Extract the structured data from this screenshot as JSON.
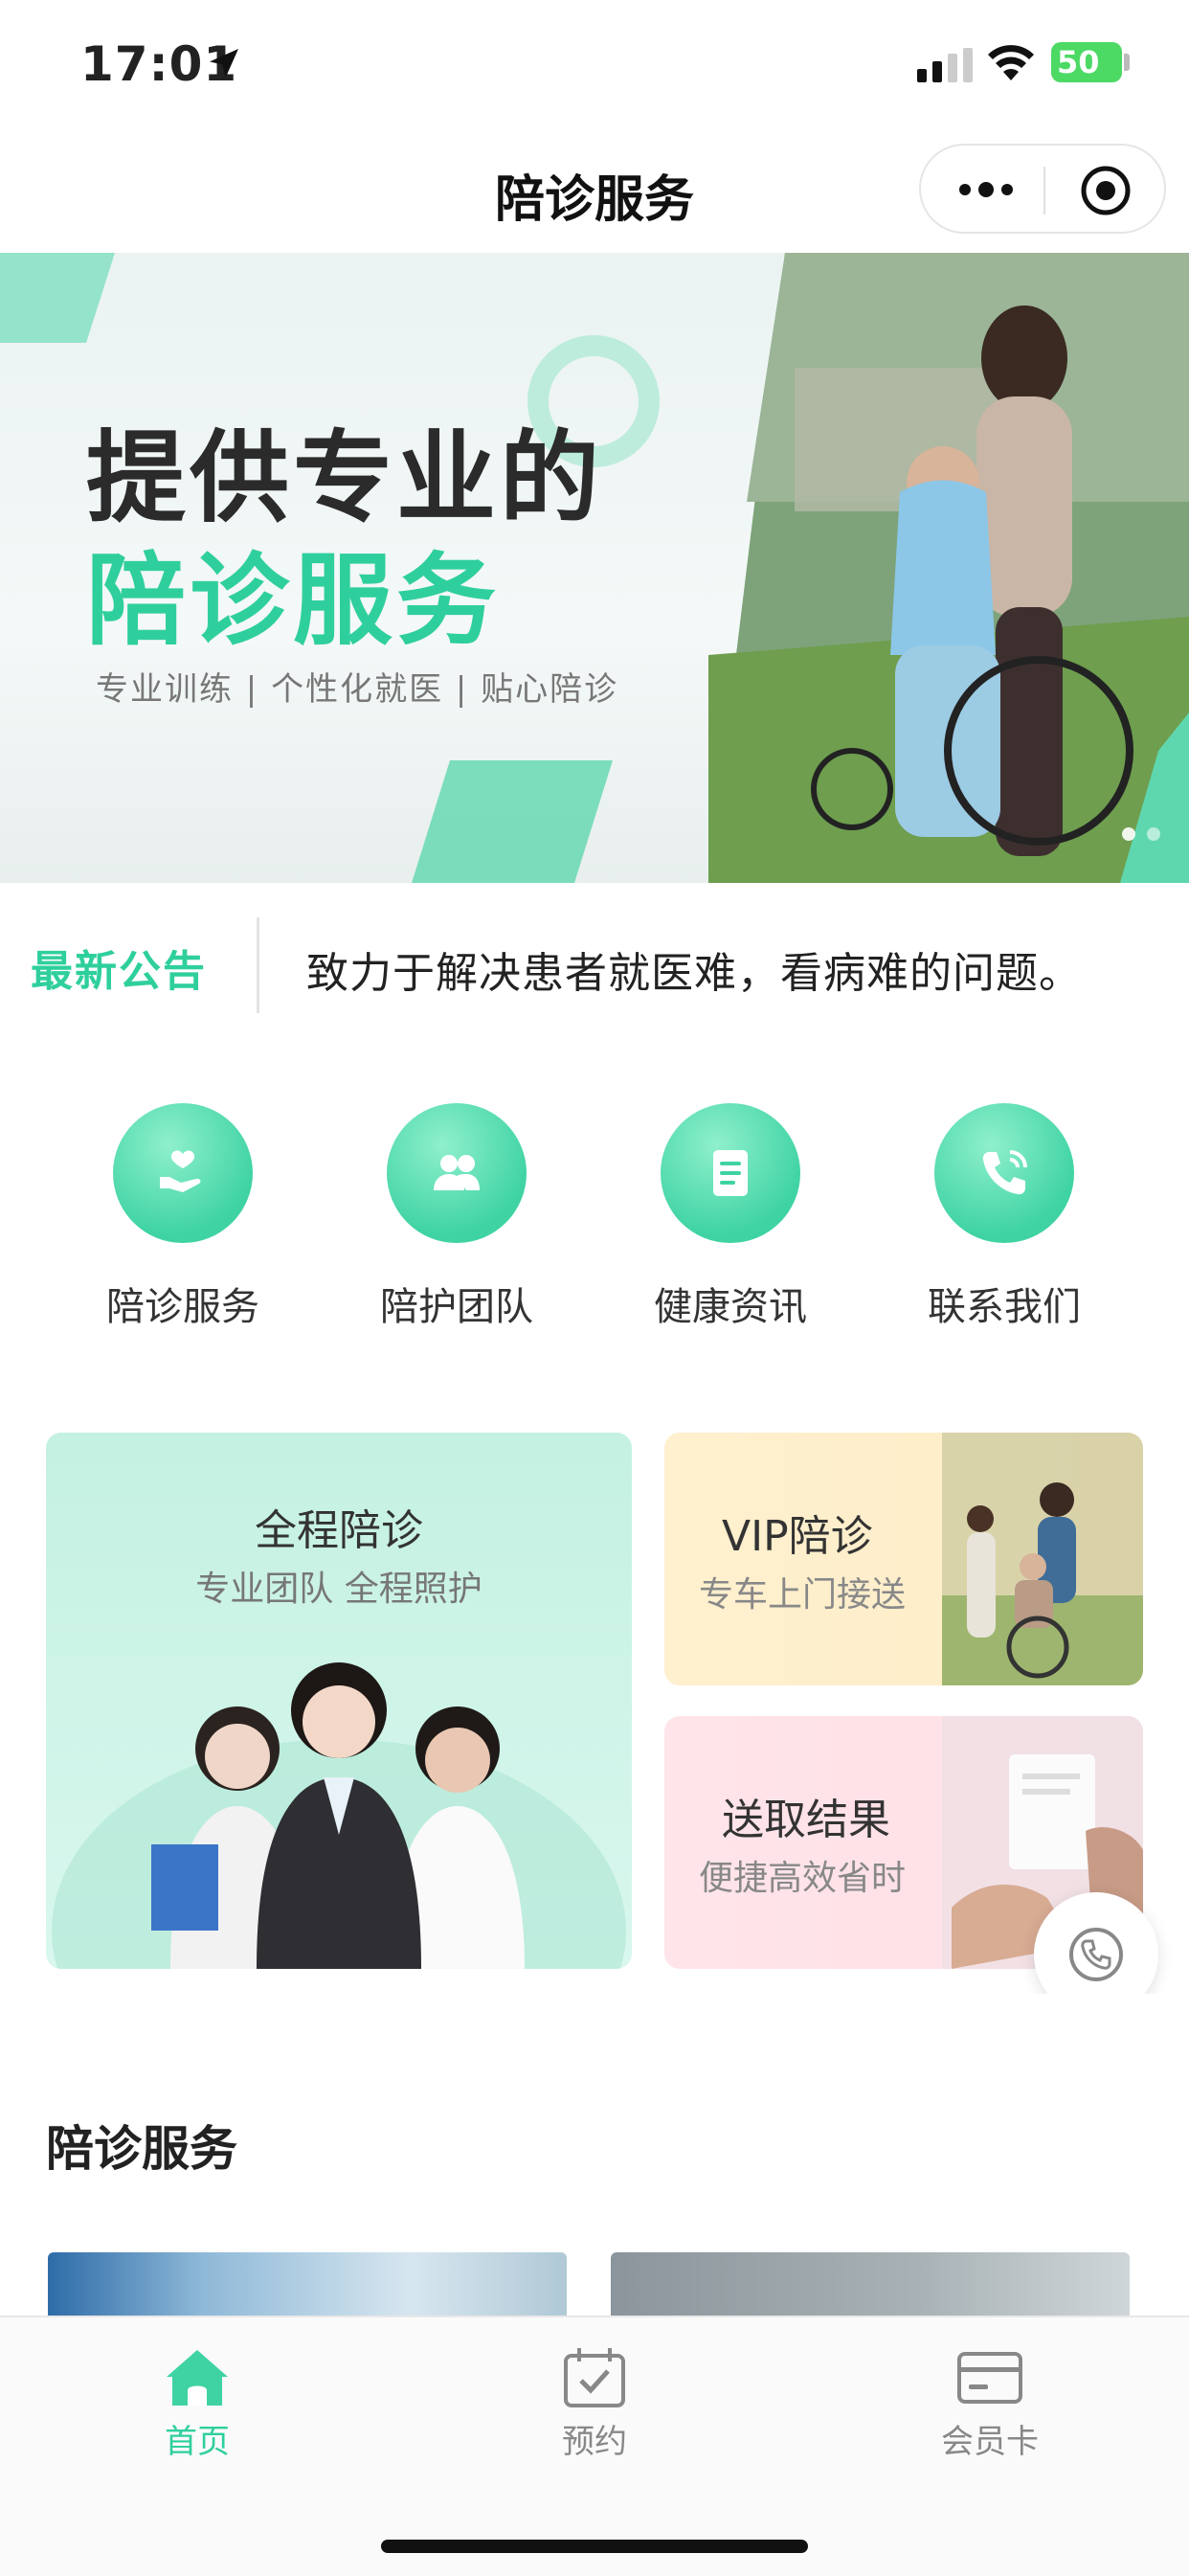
{
  "status_bar": {
    "time": "17:01",
    "battery": "50"
  },
  "nav": {
    "title": "陪诊服务"
  },
  "banner": {
    "headline_1": "提供专业的",
    "headline_2": "陪诊服务",
    "subline": "专业训练 | 个性化就医 | 贴心陪诊",
    "slides": 2,
    "active_slide": 1
  },
  "notice": {
    "label": "最新公告",
    "text": "致力于解决患者就医难，看病难的问题。"
  },
  "quick_links": [
    {
      "label": "陪诊服务",
      "icon": "hand-heart-icon"
    },
    {
      "label": "陪护团队",
      "icon": "team-icon"
    },
    {
      "label": "健康资讯",
      "icon": "document-icon"
    },
    {
      "label": "联系我们",
      "icon": "phone-icon"
    }
  ],
  "cards": {
    "full": {
      "title": "全程陪诊",
      "subtitle": "专业团队 全程照护"
    },
    "vip": {
      "title": "VIP陪诊",
      "subtitle": "专车上门接送"
    },
    "results": {
      "title": "送取结果",
      "subtitle": "便捷高效省时"
    }
  },
  "section": {
    "title": "陪诊服务"
  },
  "tabbar": {
    "items": [
      {
        "label": "首页",
        "icon": "home-icon",
        "active": true
      },
      {
        "label": "预约",
        "icon": "calendar-check-icon",
        "active": false
      },
      {
        "label": "会员卡",
        "icon": "card-icon",
        "active": false
      }
    ]
  },
  "colors": {
    "accent": "#2fcf9d",
    "text": "#222222",
    "muted": "#888888"
  }
}
